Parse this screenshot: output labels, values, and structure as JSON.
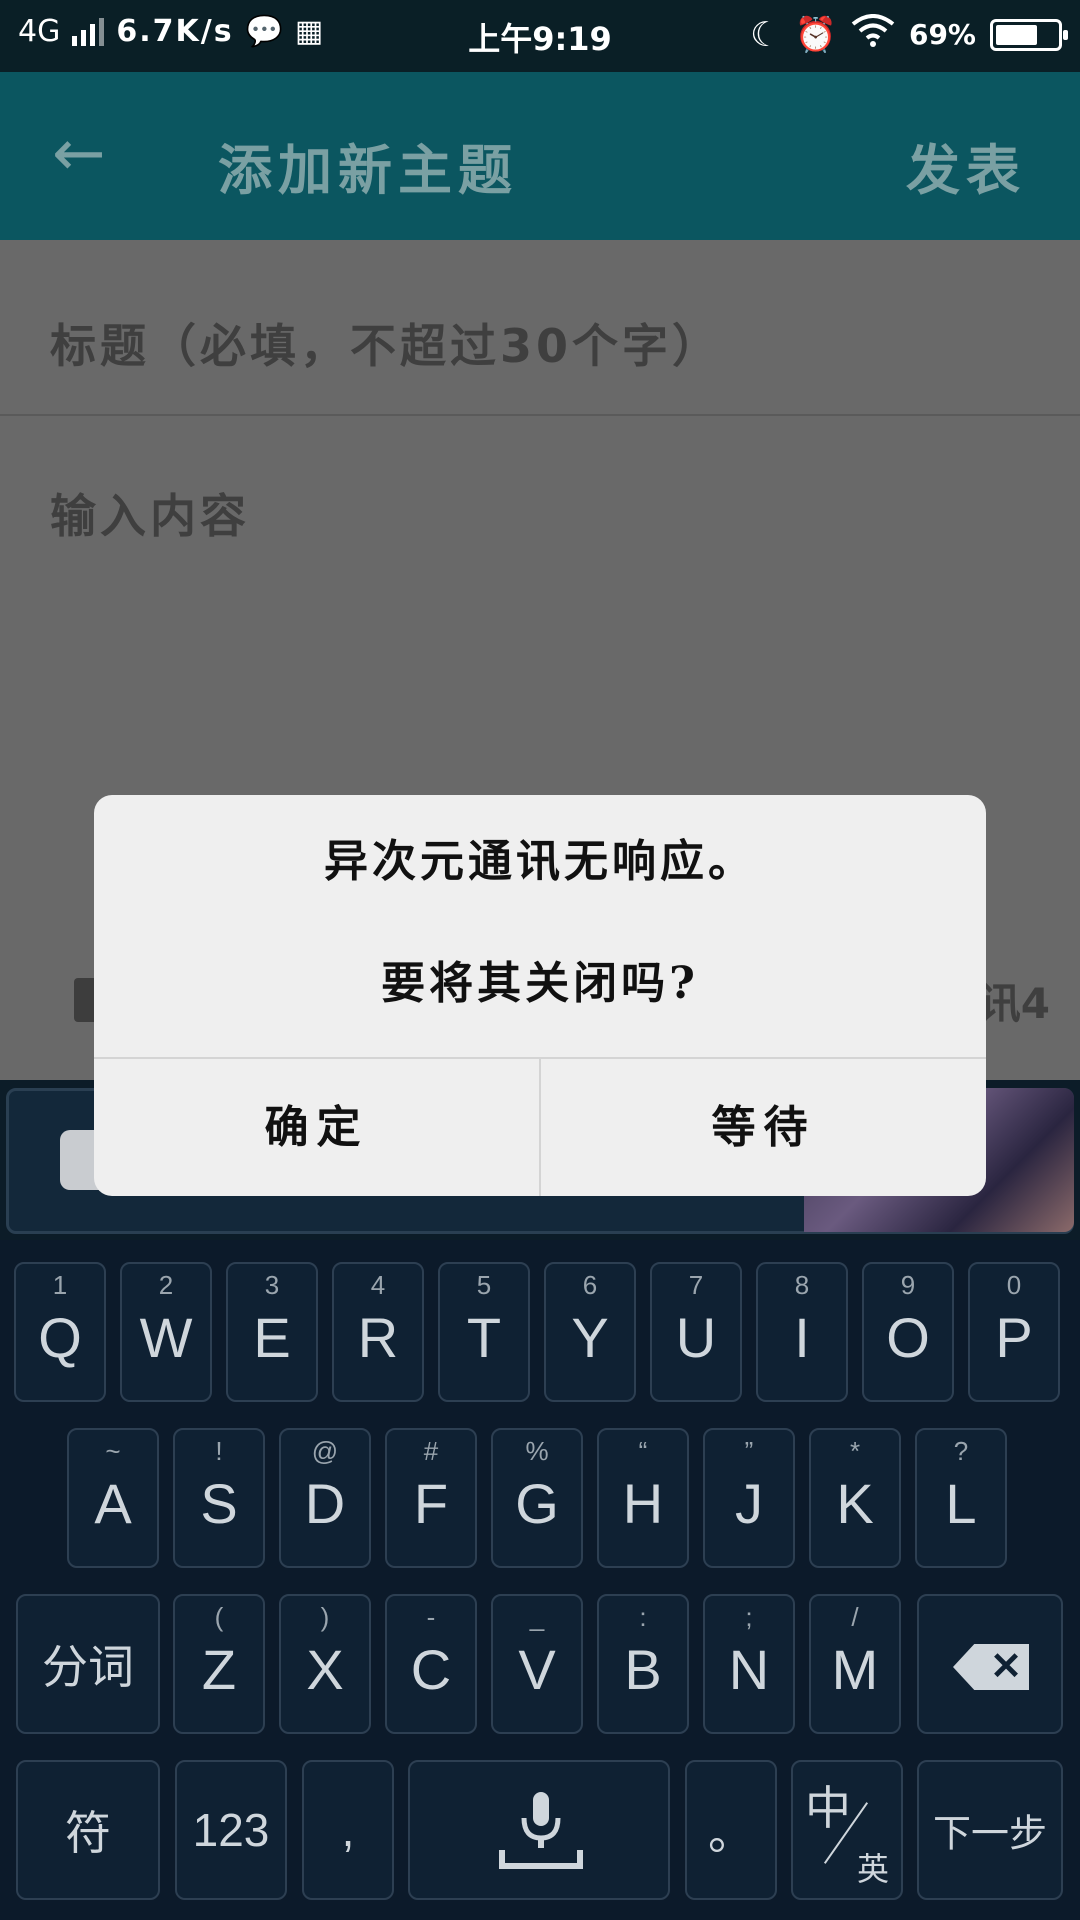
{
  "status_bar": {
    "network": "4G",
    "speed": "6.7K/s",
    "time": "上午9:19",
    "battery": "69%",
    "battery_fraction": 0.69,
    "icons": [
      "signal-icon",
      "wechat-icon",
      "keyboard-grid-icon",
      "moon-icon",
      "alarm-icon",
      "wifi-icon",
      "battery-icon"
    ]
  },
  "app_bar": {
    "back_icon": "←",
    "title": "添加新主题",
    "publish_label": "发表"
  },
  "form": {
    "title_placeholder": "标题（必填，不超过30个字）",
    "content_placeholder": "输入内容",
    "right_label": "讯4"
  },
  "dialog": {
    "message_line1": "异次元通讯无响应。",
    "message_line2": "要将其关闭吗?",
    "ok_label": "确定",
    "wait_label": "等待"
  },
  "keyboard": {
    "row1": [
      {
        "main": "Q",
        "sub": "1"
      },
      {
        "main": "W",
        "sub": "2"
      },
      {
        "main": "E",
        "sub": "3"
      },
      {
        "main": "R",
        "sub": "4"
      },
      {
        "main": "T",
        "sub": "5"
      },
      {
        "main": "Y",
        "sub": "6"
      },
      {
        "main": "U",
        "sub": "7"
      },
      {
        "main": "I",
        "sub": "8"
      },
      {
        "main": "O",
        "sub": "9"
      },
      {
        "main": "P",
        "sub": "0"
      }
    ],
    "row2": [
      {
        "main": "A",
        "sub": "~"
      },
      {
        "main": "S",
        "sub": "!"
      },
      {
        "main": "D",
        "sub": "@"
      },
      {
        "main": "F",
        "sub": "#"
      },
      {
        "main": "G",
        "sub": "%"
      },
      {
        "main": "H",
        "sub": "“"
      },
      {
        "main": "J",
        "sub": "”"
      },
      {
        "main": "K",
        "sub": "*"
      },
      {
        "main": "L",
        "sub": "?"
      }
    ],
    "row3": [
      {
        "main": "Z",
        "sub": "("
      },
      {
        "main": "X",
        "sub": ")"
      },
      {
        "main": "C",
        "sub": "-"
      },
      {
        "main": "V",
        "sub": "_"
      },
      {
        "main": "B",
        "sub": ":"
      },
      {
        "main": "N",
        "sub": ";"
      },
      {
        "main": "M",
        "sub": "/"
      }
    ],
    "segment_label": "分词",
    "delete_icon": "✕",
    "symbol_label": "符",
    "numbers_label": "123",
    "comma_label": ",",
    "mic_icon": "mic-icon",
    "period_label": "。",
    "lang_main": "中",
    "lang_sub": "英",
    "next_label": "下一步"
  }
}
